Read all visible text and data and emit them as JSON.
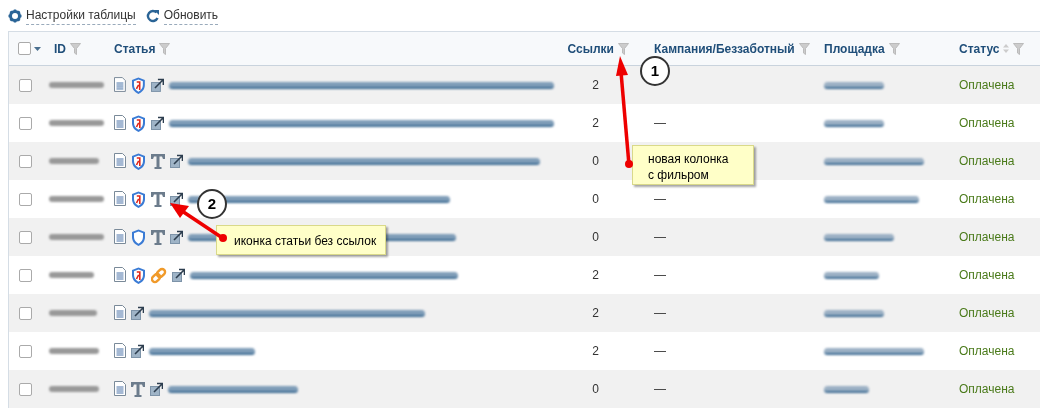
{
  "toolbar": [
    {
      "kind": "settings",
      "label": "Настройки таблицы"
    },
    {
      "kind": "refresh",
      "label": "Обновить"
    }
  ],
  "table": {
    "select_all": {
      "checked": false
    },
    "columns": [
      {
        "label": "ID",
        "sortable": false
      },
      {
        "label": "Статья",
        "sortable": false
      },
      {
        "label": "Ссылки",
        "sortable": false
      },
      {
        "label": "Кампания/Беззаботный",
        "sortable": false
      },
      {
        "label": "Площадка",
        "sortable": false
      },
      {
        "label": "Статус",
        "sortable": true
      }
    ],
    "rows": [
      {
        "checked": false,
        "icons": [
          {
            "kind": "document"
          },
          {
            "kind": "shield-marked"
          }
        ],
        "links": "2",
        "status": "Оплачена"
      },
      {
        "checked": false,
        "icons": [
          {
            "kind": "document"
          },
          {
            "kind": "shield-marked"
          }
        ],
        "links": "2",
        "campaign": "—",
        "status": "Оплачена"
      },
      {
        "checked": false,
        "icons": [
          {
            "kind": "document"
          },
          {
            "kind": "shield-marked"
          },
          {
            "kind": "text"
          }
        ],
        "links": "0",
        "status": "Оплачена"
      },
      {
        "checked": false,
        "icons": [
          {
            "kind": "document"
          },
          {
            "kind": "shield-marked"
          },
          {
            "kind": "text"
          }
        ],
        "links": "0",
        "campaign": "—",
        "status": "Оплачена"
      },
      {
        "checked": false,
        "icons": [
          {
            "kind": "document"
          },
          {
            "kind": "shield"
          },
          {
            "kind": "text"
          }
        ],
        "links": "0",
        "campaign": "—",
        "status": "Оплачена"
      },
      {
        "checked": false,
        "icons": [
          {
            "kind": "document"
          },
          {
            "kind": "shield-marked"
          },
          {
            "kind": "chain"
          }
        ],
        "links": "2",
        "campaign": "—",
        "status": "Оплачена"
      },
      {
        "checked": false,
        "icons": [
          {
            "kind": "document"
          }
        ],
        "links": "2",
        "campaign": "—",
        "status": "Оплачена"
      },
      {
        "checked": false,
        "icons": [
          {
            "kind": "document"
          }
        ],
        "links": "2",
        "campaign": "—",
        "status": "Оплачена"
      },
      {
        "checked": false,
        "icons": [
          {
            "kind": "document"
          },
          {
            "kind": "text"
          }
        ],
        "links": "0",
        "campaign": "—",
        "status": "Оплачена"
      }
    ]
  },
  "annotations": [
    {
      "number": "1",
      "note": "новая колонка\nс фильром"
    },
    {
      "number": "2",
      "note": "иконка статьи без ссылок"
    }
  ]
}
